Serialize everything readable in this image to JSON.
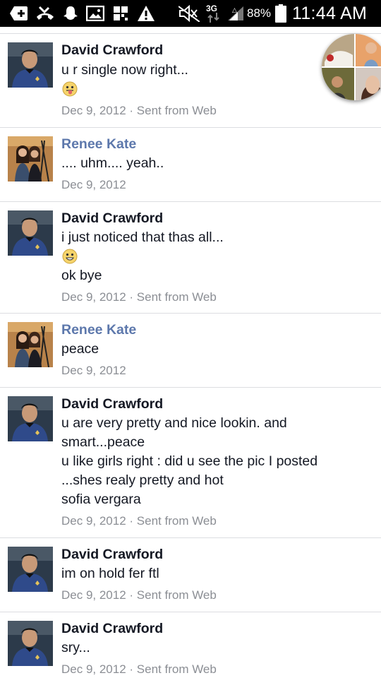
{
  "status_bar": {
    "battery_percent": "88%",
    "network": "3G",
    "time": "11:44 AM",
    "icons": [
      "add-icon",
      "missed-call-icon",
      "ghost-icon",
      "gallery-icon",
      "grid-icon",
      "warning-icon",
      "mute-icon",
      "network-icon",
      "signal-icon",
      "battery-icon"
    ]
  },
  "messages": [
    {
      "sender": "David Crawford",
      "lines": [
        "u r single now right..."
      ],
      "emoji_after": 1,
      "meta": "Dec 9, 2012 · Sent from Web",
      "avatar": "spock"
    },
    {
      "sender": "Renee Kate",
      "lines": [
        ".... uhm.... yeah.."
      ],
      "meta": "Dec 9, 2012",
      "avatar": "renee"
    },
    {
      "sender": "David Crawford",
      "lines": [
        "i just noticed that thas all...",
        "ok bye"
      ],
      "emoji_after": 1,
      "meta": "Dec 9, 2012 · Sent from Web",
      "avatar": "spock"
    },
    {
      "sender": "Renee Kate",
      "lines": [
        "peace"
      ],
      "meta": "Dec 9, 2012",
      "avatar": "renee"
    },
    {
      "sender": "David Crawford",
      "lines": [
        "u are very pretty and nice lookin. and",
        "smart...peace",
        "u like girls right : did u see the pic I posted",
        "...shes realy pretty and hot",
        "sofia vergara"
      ],
      "meta": "Dec 9, 2012 · Sent from Web",
      "avatar": "spock"
    },
    {
      "sender": "David Crawford",
      "lines": [
        "im on hold fer ftl"
      ],
      "meta": "Dec 9, 2012 · Sent from Web",
      "avatar": "spock"
    },
    {
      "sender": "David Crawford",
      "lines": [
        "sry..."
      ],
      "meta": "Dec 9, 2012 · Sent from Web",
      "avatar": "spock"
    }
  ],
  "colors": {
    "sender_david": "#141823",
    "sender_renee": "#5d78ac",
    "meta": "#8b8e94",
    "divider": "#dcdde1"
  }
}
